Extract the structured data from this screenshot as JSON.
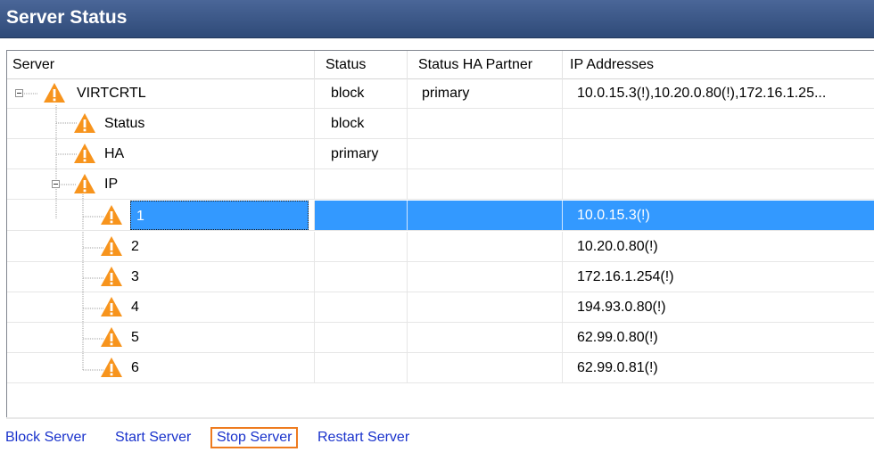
{
  "window": {
    "title": "Server Status"
  },
  "grid": {
    "columns": [
      "Server",
      "Status",
      "Status HA Partner",
      "IP Addresses"
    ],
    "rows": [
      {
        "server": "VIRTCRTL",
        "status": "block",
        "ha_partner": "primary",
        "ip": "10.0.15.3(!),10.20.0.80(!),172.16.1.25..."
      },
      {
        "server": "Status",
        "status": "block",
        "ha_partner": "",
        "ip": ""
      },
      {
        "server": "HA",
        "status": "primary",
        "ha_partner": "",
        "ip": ""
      },
      {
        "server": "IP",
        "status": "",
        "ha_partner": "",
        "ip": ""
      },
      {
        "server": "1",
        "status": "",
        "ha_partner": "",
        "ip": "10.0.15.3(!)"
      },
      {
        "server": "2",
        "status": "",
        "ha_partner": "",
        "ip": "10.20.0.80(!)"
      },
      {
        "server": "3",
        "status": "",
        "ha_partner": "",
        "ip": "172.16.1.254(!)"
      },
      {
        "server": "4",
        "status": "",
        "ha_partner": "",
        "ip": "194.93.0.80(!)"
      },
      {
        "server": "5",
        "status": "",
        "ha_partner": "",
        "ip": "62.99.0.80(!)"
      },
      {
        "server": "6",
        "status": "",
        "ha_partner": "",
        "ip": "62.99.0.81(!)"
      }
    ]
  },
  "actions": {
    "block": "Block Server",
    "start": "Start Server",
    "stop": "Stop Server",
    "restart": "Restart Server"
  },
  "icons": {
    "node": "warning-icon",
    "expand": "collapse-minus-icon"
  },
  "colors": {
    "title_bar": "#3a5686",
    "selection": "#3399ff",
    "warning": "#f7941d",
    "link": "#1a33cc",
    "focus_border": "#ee7b1f"
  }
}
